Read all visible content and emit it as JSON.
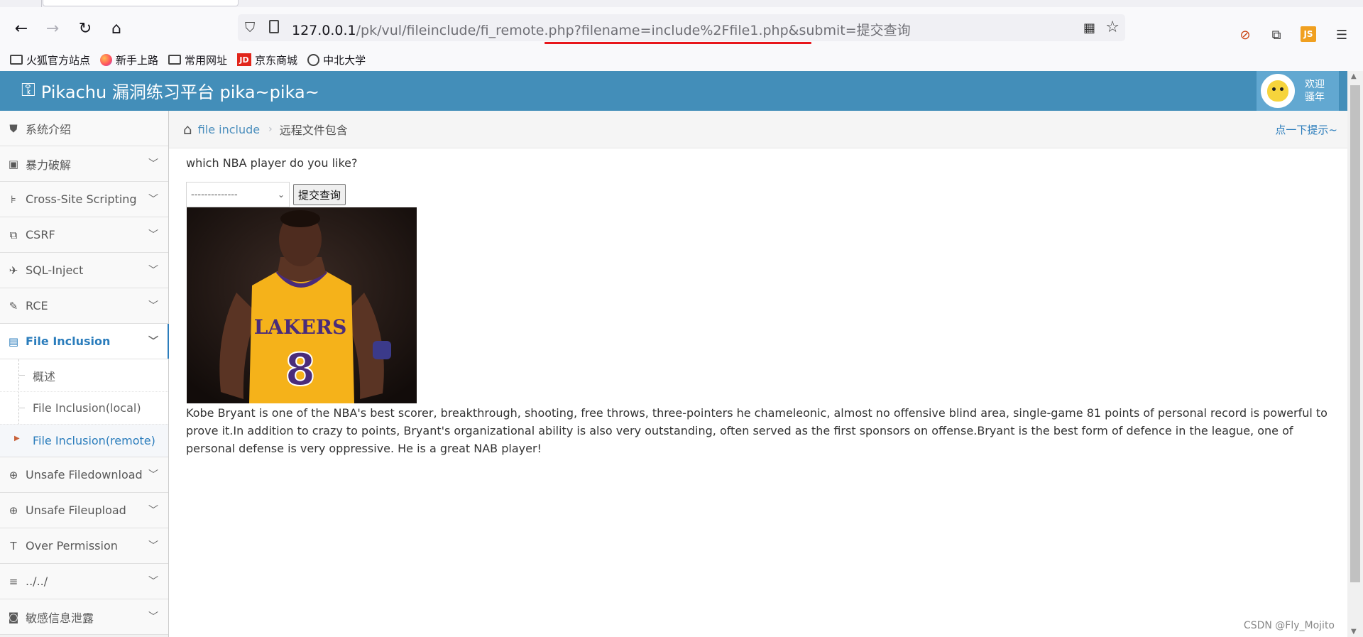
{
  "browser": {
    "url_host": "127.0.0.1",
    "url_path": "/pk/vul/fileinclude/fi_remote.php?",
    "url_query": "filename=include%2Ffile1.php&submit=提交查询",
    "ext_js_label": "JS",
    "bookmarks": [
      "火狐官方站点",
      "新手上路",
      "常用网址",
      "京东商城",
      "中北大学"
    ],
    "jd_icon_text": "JD"
  },
  "header": {
    "title": "Pikachu 漏洞练习平台 pika~pika~",
    "welcome_line1": "欢迎",
    "welcome_line2": "骚年"
  },
  "sidebar": {
    "items": [
      {
        "label": "系统介绍",
        "icon": "tags-icon"
      },
      {
        "label": "暴力破解",
        "icon": "lock-icon"
      },
      {
        "label": "Cross-Site Scripting",
        "icon": "sitemap-icon"
      },
      {
        "label": "CSRF",
        "icon": "external-link-icon"
      },
      {
        "label": "SQL-Inject",
        "icon": "fighter-jet-icon"
      },
      {
        "label": "RCE",
        "icon": "pencil-icon"
      },
      {
        "label": "File Inclusion",
        "icon": "file-icon"
      },
      {
        "label": "Unsafe Filedownload",
        "icon": "download-icon"
      },
      {
        "label": "Unsafe Fileupload",
        "icon": "upload-icon"
      },
      {
        "label": "Over Permission",
        "icon": "text-height-icon"
      },
      {
        "label": "../../",
        "icon": "align-left-icon"
      },
      {
        "label": "敏感信息泄露",
        "icon": "camera-icon"
      }
    ],
    "submenu": [
      "概述",
      "File Inclusion(local)",
      "File Inclusion(remote)"
    ]
  },
  "breadcrumb": {
    "link": "file include",
    "current": "远程文件包含",
    "hint": "点一下提示~"
  },
  "main": {
    "question": "which NBA player do you like?",
    "select_value": "--------------",
    "submit_label": "提交查询",
    "jersey_text": "LAKERS",
    "jersey_number": "8",
    "description": "Kobe Bryant is one of the NBA's best scorer, breakthrough, shooting, free throws, three-pointers he chameleonic, almost no offensive blind area, single-game 81 points of personal record is powerful to prove it.In addition to crazy to points, Bryant's organizational ability is also very outstanding, often served as the first sponsors on offense.Bryant is the best form of defence in the league, one of personal defense is very oppressive. He is a great NAB player!"
  },
  "watermark": "CSDN @Fly_Mojito",
  "colors": {
    "header_bg": "#438eb9",
    "accent": "#2b7dbc",
    "url_underline": "#e8161b"
  }
}
